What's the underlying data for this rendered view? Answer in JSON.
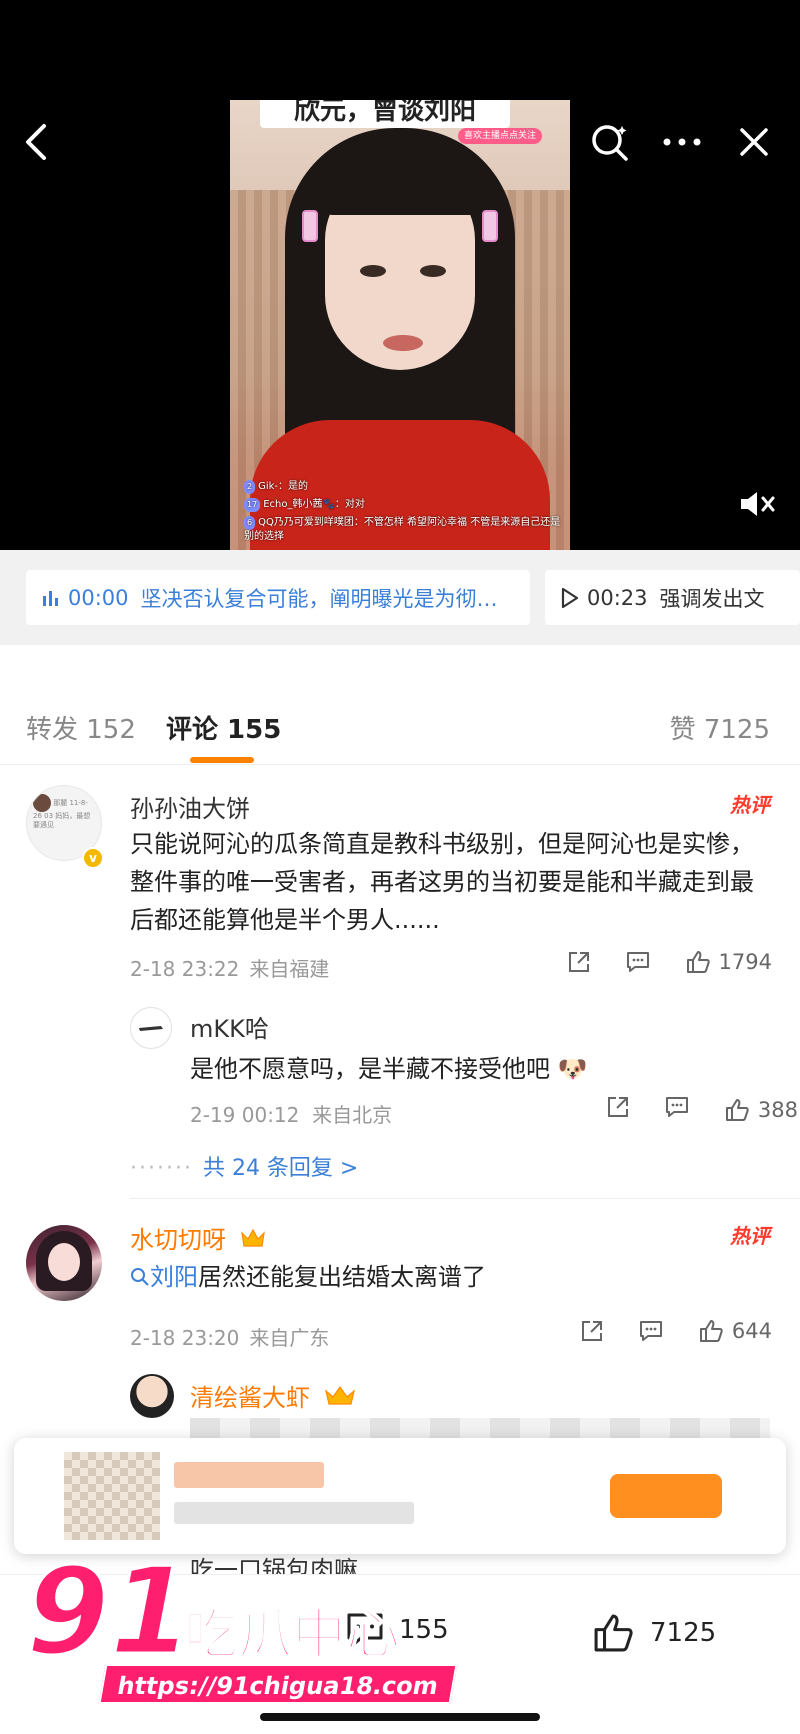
{
  "video": {
    "caption_top": "欣元，曾谈刘阳",
    "live_tag": "喜欢主播点点关注",
    "danmaku": [
      {
        "level": "2",
        "text": "Gik-：是的"
      },
      {
        "level": "17",
        "text": "Echo_韩小茜🐾：对对"
      },
      {
        "level": "6",
        "text": "QQ乃乃可爱到咩噗团：不管怎样 希望阿沁幸福 不管是来源自己还是别的选择"
      }
    ]
  },
  "chapters": [
    {
      "time": "00:00",
      "text": "坚决否认复合可能，阐明曝光是为彻…",
      "active": true
    },
    {
      "time": "00:23",
      "text": "强调发出文",
      "active": false
    }
  ],
  "tabs": {
    "repost": "转发 152",
    "comment": "评论 155",
    "like": "赞 7125"
  },
  "comments": [
    {
      "avatar_text": "那麓 11-8-26 03 妈妈，最想要遇见",
      "name": "孙孙油大饼",
      "hot": "热评",
      "text": "只能说阿沁的瓜条简直是教科书级别，但是阿沁也是实惨，整件事的唯一受害者，再者这男的当初要是能和半藏走到最后都还能算他是半个男人......",
      "time": "2-18 23:22",
      "location": "来自福建",
      "likes": "1794",
      "reply": {
        "name": "mKK哈",
        "text": "是他不愿意吗，是半藏不接受他吧",
        "emoji": "🐶",
        "time": "2-19 00:12",
        "location": "来自北京",
        "likes": "388"
      },
      "more_replies": "共 24 条回复 >"
    },
    {
      "name": "水切切呀",
      "hot": "热评",
      "link_word": "刘阳",
      "text": "居然还能复出结婚太离谱了",
      "time": "2-18 23:20",
      "location": "来自广东",
      "likes": "644",
      "reply": {
        "name": "清绘酱大虾",
        "partial_text": "吃一口锅包肉嘛"
      }
    }
  ],
  "bottom_bar": {
    "comment_count": "155",
    "like_count": "7125"
  },
  "watermark": {
    "number": "91",
    "brand": "吃瓜中心",
    "url": "https://91chigua18.com"
  },
  "colors": {
    "accent_orange": "#ff8200",
    "link_blue": "#3b7fd8",
    "hot_red": "#ff3a2d",
    "watermark_pink": "#ff1f6e"
  }
}
